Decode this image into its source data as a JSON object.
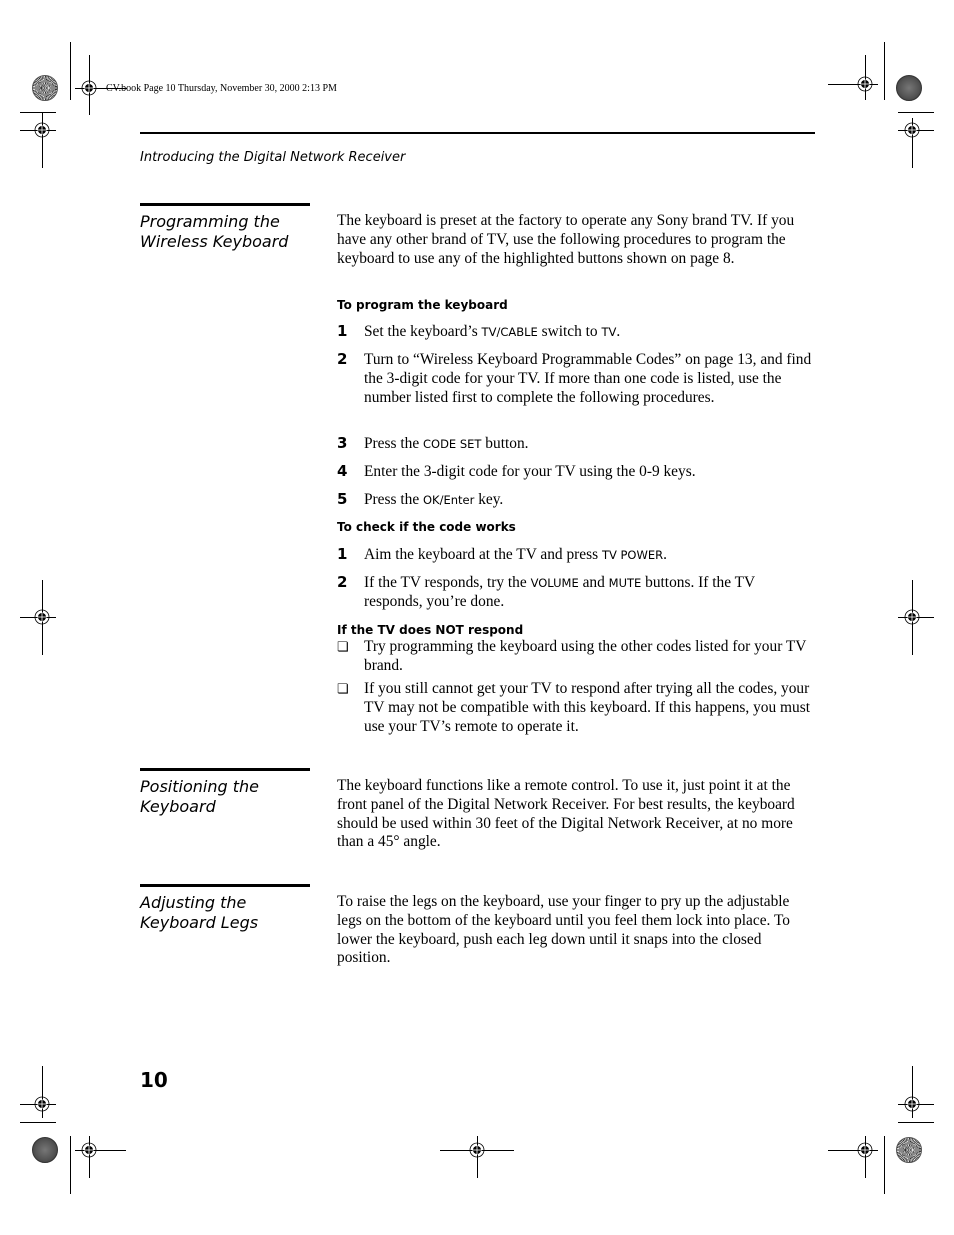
{
  "slug": "CV.book  Page 10  Thursday, November 30, 2000  2:13 PM",
  "running_head": "Introducing the Digital Network Receiver",
  "page_number": "10",
  "sections": [
    {
      "title_line1": "Programming the",
      "title_line2": "Wireless Keyboard",
      "intro": "The keyboard is preset at the factory to operate any Sony brand TV. If you have any other brand of TV, use the following procedures to program the keyboard to use any of the highlighted buttons shown on page 8.",
      "procedures": [
        {
          "heading": "To program the keyboard",
          "steps": [
            {
              "num": "1",
              "pre": "Set the keyboard’s ",
              "key1": "TV/CABLE",
              "mid": " switch to ",
              "key2": "TV",
              "post": "."
            },
            {
              "num": "2",
              "text": "Turn to “Wireless Keyboard Programmable Codes” on page 13, and find the 3-digit code for your TV. If more than one code is listed, use the number listed first to complete the following procedures."
            },
            {
              "num": "3",
              "pre": "Press the ",
              "key1": "CODE SET",
              "post": " button."
            },
            {
              "num": "4",
              "text": "Enter the 3-digit code for your TV using the 0-9 keys."
            },
            {
              "num": "5",
              "pre": "Press the ",
              "key1": "OK/Enter",
              "post": " key."
            }
          ]
        },
        {
          "heading": "To check if the code works",
          "steps": [
            {
              "num": "1",
              "pre": "Aim the keyboard at the TV and press ",
              "key1": "TV POWER",
              "post": "."
            },
            {
              "num": "2",
              "pre": "If the TV responds, try the ",
              "key1": "VOLUME",
              "mid": " and ",
              "key2": "MUTE",
              "post": " buttons. If the TV responds, you’re done."
            }
          ]
        },
        {
          "heading": "If the TV does NOT respond",
          "bullets": [
            "Try programming the keyboard using the other codes listed for your TV brand.",
            "If you still cannot get your TV to respond after trying all the codes, your TV may not be compatible with this keyboard. If this happens, you must use your TV’s remote to operate it."
          ],
          "bullet_icon": "❏"
        }
      ]
    },
    {
      "title_line1": "Positioning the",
      "title_line2": "Keyboard",
      "body": "The keyboard functions like a remote control. To use it, just point it at the front panel of the Digital Network Receiver. For best results, the keyboard should be used within 30 feet of the Digital Network Receiver, at no more than a 45° angle."
    },
    {
      "title_line1": "Adjusting the",
      "title_line2": "Keyboard Legs",
      "body": "To raise the legs on the keyboard, use your finger to pry up the adjustable legs on the bottom of the keyboard until you feel them lock into place. To lower the keyboard, push each leg down until it snaps into the closed position."
    }
  ]
}
